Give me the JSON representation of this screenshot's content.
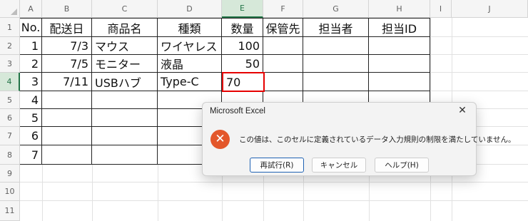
{
  "sheet": {
    "column_headers": [
      "A",
      "B",
      "C",
      "D",
      "E",
      "F",
      "G",
      "H",
      "I",
      "J"
    ],
    "row_headers": [
      "1",
      "2",
      "3",
      "4",
      "5",
      "6",
      "7",
      "8",
      "9",
      "10",
      "11"
    ],
    "selected_column": "E",
    "selected_row": "4",
    "table": {
      "headers": [
        "No.",
        "配送日",
        "商品名",
        "種類",
        "数量",
        "保管先",
        "担当者",
        "担当ID"
      ],
      "rows": [
        [
          "1",
          "7/3",
          "マウス",
          "ワイヤレス",
          "100",
          "",
          "",
          ""
        ],
        [
          "2",
          "7/5",
          "モニター",
          "液晶",
          "50",
          "",
          "",
          ""
        ],
        [
          "3",
          "7/11",
          "USBハブ",
          "Type-C",
          "",
          "",
          "",
          ""
        ],
        [
          "4",
          "",
          "",
          "",
          "",
          "",
          "",
          ""
        ],
        [
          "5",
          "",
          "",
          "",
          "",
          "",
          "",
          ""
        ],
        [
          "6",
          "",
          "",
          "",
          "",
          "",
          "",
          ""
        ],
        [
          "7",
          "",
          "",
          "",
          "",
          "",
          "",
          ""
        ]
      ]
    },
    "active_cell_value": "70",
    "active_cell_highlight_color": "#e60000"
  },
  "dialog": {
    "title": "Microsoft Excel",
    "close_glyph": "✕",
    "icon": "error-x-icon",
    "icon_glyph": "✕",
    "icon_color": "#e3572b",
    "message": "この値は、このセルに定義されているデータ入力規則の制限を満たしていません。",
    "buttons": {
      "retry": "再試行(R)",
      "cancel": "キャンセル",
      "help": "ヘルプ(H)"
    }
  }
}
